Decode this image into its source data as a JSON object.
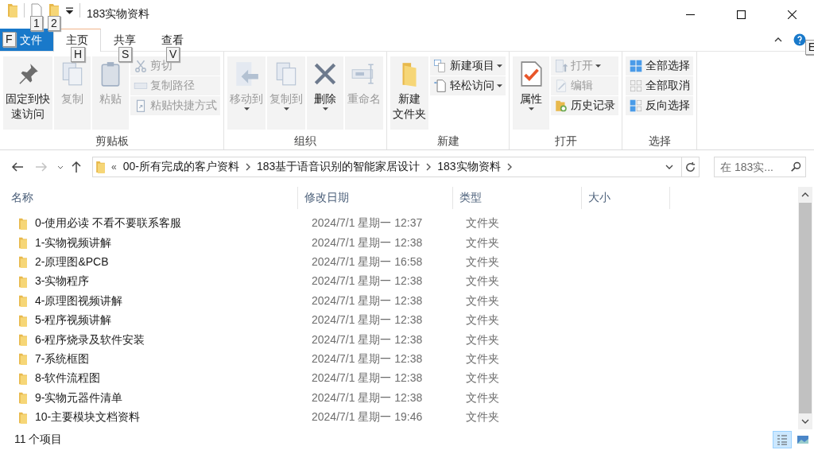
{
  "window": {
    "title": "183实物资料"
  },
  "quick_access_keytips": [
    "1",
    "2"
  ],
  "tabs": [
    {
      "label": "文件",
      "selected": false,
      "kind": "file",
      "keytip": "F"
    },
    {
      "label": "主页",
      "selected": true,
      "kind": "tab",
      "keytip": "H"
    },
    {
      "label": "共享",
      "selected": false,
      "kind": "tab",
      "keytip": "S"
    },
    {
      "label": "查看",
      "selected": false,
      "kind": "tab",
      "keytip": "V"
    }
  ],
  "help_keytip": "E",
  "ribbon": {
    "groups": [
      {
        "label": "剪贴板",
        "items": [
          {
            "kind": "large",
            "label": [
              "固定到快",
              "速访问"
            ],
            "disabled": false,
            "dropdown": false
          },
          {
            "kind": "large",
            "label": [
              "复制"
            ],
            "disabled": true,
            "dropdown": false
          },
          {
            "kind": "large",
            "label": [
              "粘贴"
            ],
            "disabled": true,
            "dropdown": false
          },
          {
            "kind": "stack",
            "items": [
              {
                "label": "剪切",
                "disabled": true,
                "dropdown": false
              },
              {
                "label": "复制路径",
                "disabled": true,
                "dropdown": false
              },
              {
                "label": "粘贴快捷方式",
                "disabled": true,
                "dropdown": false
              }
            ]
          }
        ]
      },
      {
        "label": "组织",
        "items": [
          {
            "kind": "large",
            "label": [
              "移动到"
            ],
            "disabled": true,
            "dropdown": true
          },
          {
            "kind": "large",
            "label": [
              "复制到"
            ],
            "disabled": true,
            "dropdown": true
          },
          {
            "kind": "large",
            "label": [
              "删除"
            ],
            "disabled": false,
            "dropdown": true
          },
          {
            "kind": "large",
            "label": [
              "重命名"
            ],
            "disabled": true,
            "dropdown": false
          }
        ]
      },
      {
        "label": "新建",
        "items": [
          {
            "kind": "large",
            "label": [
              "新建",
              "文件夹"
            ],
            "disabled": false,
            "dropdown": false
          },
          {
            "kind": "stack",
            "items": [
              {
                "label": "新建项目",
                "disabled": false,
                "dropdown": true
              },
              {
                "label": "轻松访问",
                "disabled": false,
                "dropdown": true
              }
            ]
          }
        ]
      },
      {
        "label": "打开",
        "items": [
          {
            "kind": "large",
            "label": [
              "属性"
            ],
            "disabled": false,
            "dropdown": true
          },
          {
            "kind": "stack",
            "items": [
              {
                "label": "打开",
                "disabled": true,
                "dropdown": true
              },
              {
                "label": "编辑",
                "disabled": true,
                "dropdown": false
              },
              {
                "label": "历史记录",
                "disabled": false,
                "dropdown": false
              }
            ]
          }
        ]
      },
      {
        "label": "选择",
        "items": [
          {
            "kind": "stack",
            "items": [
              {
                "label": "全部选择",
                "disabled": false,
                "dropdown": false
              },
              {
                "label": "全部取消",
                "disabled": false,
                "dropdown": false
              },
              {
                "label": "反向选择",
                "disabled": false,
                "dropdown": false
              }
            ]
          }
        ]
      }
    ]
  },
  "navigation": {
    "forward_disabled": true,
    "overflow_mark": "«",
    "breadcrumbs": [
      "00-所有完成的客户资料",
      "183基于语音识别的智能家居设计",
      "183实物资料"
    ],
    "search": {
      "placeholder": "在 183实..."
    }
  },
  "table": {
    "columns": [
      "名称",
      "修改日期",
      "类型",
      "大小"
    ],
    "rows": [
      {
        "name": "0-使用必读  不看不要联系客服",
        "date": "2024/7/1 星期一 12:37",
        "type": "文件夹"
      },
      {
        "name": "1-实物视频讲解",
        "date": "2024/7/1 星期一 12:38",
        "type": "文件夹"
      },
      {
        "name": "2-原理图&PCB",
        "date": "2024/7/1 星期一 16:58",
        "type": "文件夹"
      },
      {
        "name": "3-实物程序",
        "date": "2024/7/1 星期一 12:38",
        "type": "文件夹"
      },
      {
        "name": "4-原理图视频讲解",
        "date": "2024/7/1 星期一 12:38",
        "type": "文件夹"
      },
      {
        "name": "5-程序视频讲解",
        "date": "2024/7/1 星期一 12:38",
        "type": "文件夹"
      },
      {
        "name": "6-程序烧录及软件安装",
        "date": "2024/7/1 星期一 12:38",
        "type": "文件夹"
      },
      {
        "name": "7-系统框图",
        "date": "2024/7/1 星期一 12:38",
        "type": "文件夹"
      },
      {
        "name": "8-软件流程图",
        "date": "2024/7/1 星期一 12:38",
        "type": "文件夹"
      },
      {
        "name": "9-实物元器件清单",
        "date": "2024/7/1 星期一 12:38",
        "type": "文件夹"
      },
      {
        "name": "10-主要模块文档资料",
        "date": "2024/7/1 星期一 19:46",
        "type": "文件夹"
      }
    ]
  },
  "status_bar": {
    "count": "11 个项目",
    "views": [
      {
        "selected": true
      },
      {
        "selected": false
      }
    ]
  }
}
